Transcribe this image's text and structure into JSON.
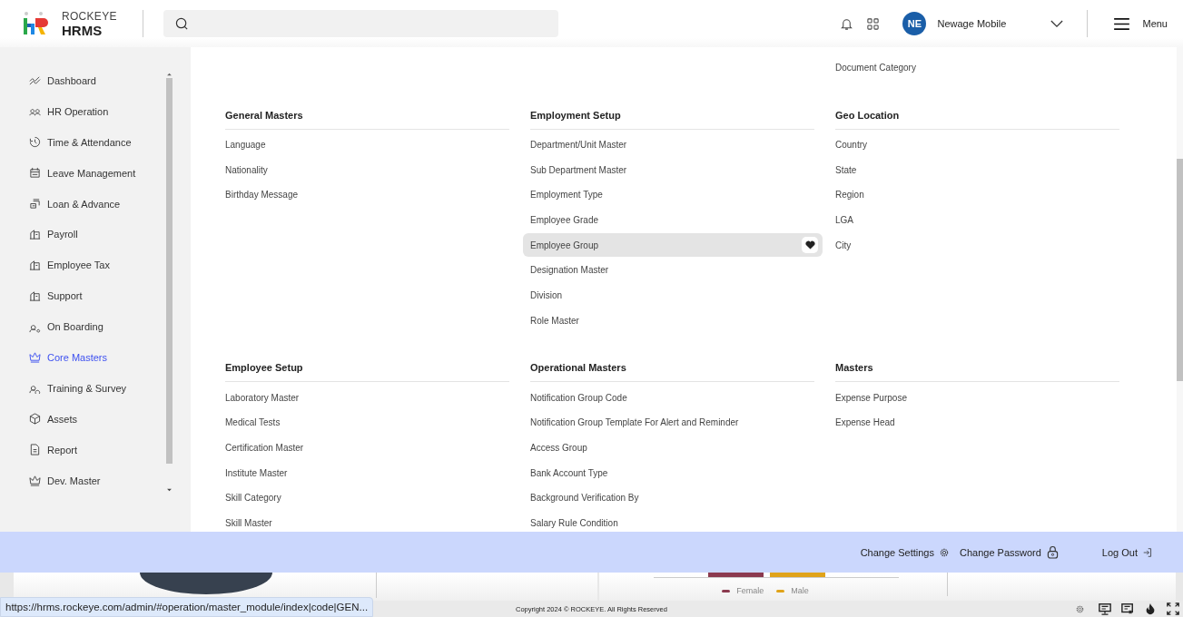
{
  "header": {
    "logo_top": "ROCKEYE",
    "logo_bottom": "HRMS",
    "avatar_initials": "NE",
    "user_name": "Newage Mobile",
    "menu_label": "Menu"
  },
  "sidebar": {
    "items": [
      {
        "label": "Dashboard",
        "selected": false
      },
      {
        "label": "HR Operation",
        "selected": false
      },
      {
        "label": "Time & Attendance",
        "selected": false
      },
      {
        "label": "Leave Management",
        "selected": false
      },
      {
        "label": "Loan & Advance",
        "selected": false
      },
      {
        "label": "Payroll",
        "selected": false
      },
      {
        "label": "Employee Tax",
        "selected": false
      },
      {
        "label": "Support",
        "selected": false
      },
      {
        "label": "On Boarding",
        "selected": false
      },
      {
        "label": "Core Masters",
        "selected": true
      },
      {
        "label": "Training & Survey",
        "selected": false
      },
      {
        "label": "Assets",
        "selected": false
      },
      {
        "label": "Report",
        "selected": false
      },
      {
        "label": "Dev. Master",
        "selected": false
      }
    ]
  },
  "overflow_items": [
    "Document Category"
  ],
  "sections": [
    {
      "title": "General Masters",
      "items": [
        {
          "label": "Language",
          "highlighted": false
        },
        {
          "label": "Nationality",
          "highlighted": false
        },
        {
          "label": "Birthday Message",
          "highlighted": false
        }
      ]
    },
    {
      "title": "Employment Setup",
      "items": [
        {
          "label": "Department/Unit Master",
          "highlighted": false
        },
        {
          "label": "Sub Department Master",
          "highlighted": false
        },
        {
          "label": "Employment Type",
          "highlighted": false
        },
        {
          "label": "Employee Grade",
          "highlighted": false
        },
        {
          "label": "Employee Group",
          "highlighted": true
        },
        {
          "label": "Designation Master",
          "highlighted": false
        },
        {
          "label": "Division",
          "highlighted": false
        },
        {
          "label": "Role Master",
          "highlighted": false
        }
      ]
    },
    {
      "title": "Geo Location",
      "items": [
        {
          "label": "Country",
          "highlighted": false
        },
        {
          "label": "State",
          "highlighted": false
        },
        {
          "label": "Region",
          "highlighted": false
        },
        {
          "label": "LGA",
          "highlighted": false
        },
        {
          "label": "City",
          "highlighted": false
        }
      ]
    },
    {
      "title": "Employee Setup",
      "items": [
        {
          "label": "Laboratory Master",
          "highlighted": false
        },
        {
          "label": "Medical Tests",
          "highlighted": false
        },
        {
          "label": "Certification Master",
          "highlighted": false
        },
        {
          "label": "Institute Master",
          "highlighted": false
        },
        {
          "label": "Skill Category",
          "highlighted": false
        },
        {
          "label": "Skill Master",
          "highlighted": false
        }
      ]
    },
    {
      "title": "Operational Masters",
      "items": [
        {
          "label": "Notification Group Code",
          "highlighted": false
        },
        {
          "label": "Notification Group Template For Alert and Reminder",
          "highlighted": false
        },
        {
          "label": "Access Group",
          "highlighted": false
        },
        {
          "label": "Bank Account Type",
          "highlighted": false
        },
        {
          "label": "Background Verification By",
          "highlighted": false
        },
        {
          "label": "Salary Rule Condition",
          "highlighted": false
        }
      ]
    },
    {
      "title": "Masters",
      "items": [
        {
          "label": "Expense Purpose",
          "highlighted": false
        },
        {
          "label": "Expense Head",
          "highlighted": false
        }
      ]
    }
  ],
  "account_actions": [
    {
      "label": "Change Settings",
      "kind": "settings"
    },
    {
      "label": "Change Password",
      "kind": "password"
    },
    {
      "label": "Log Out",
      "kind": "logout"
    }
  ],
  "background_legend": [
    {
      "label": "Female",
      "color": "#8b3a4f"
    },
    {
      "label": "Male",
      "color": "#e0a31a"
    }
  ],
  "status_url": "https://hrms.rockeye.com/admin/#operation/master_module/index|code|GEN...",
  "copyright": "Copyright 2024 © ROCKEYE. All Rights Reserved"
}
